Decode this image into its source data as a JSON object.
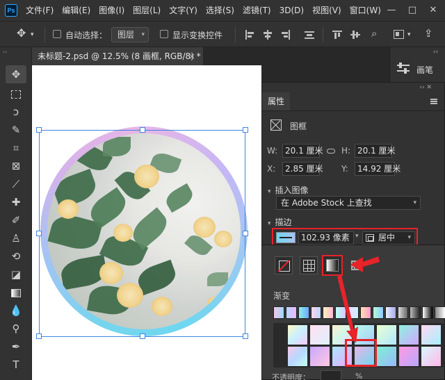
{
  "app": {
    "logo_text": "Ps",
    "menu": [
      "文件(F)",
      "编辑(E)",
      "图像(I)",
      "图层(L)",
      "文字(Y)",
      "选择(S)",
      "滤镜(T)",
      "3D(D)",
      "视图(V)",
      "窗口(W)"
    ],
    "window_controls": [
      "—",
      "□",
      "✕"
    ]
  },
  "options_bar": {
    "auto_select_label": "自动选择：",
    "auto_select_value": "图层",
    "show_transform_label": "显示变换控件"
  },
  "document": {
    "tab_title": "未标题-2.psd @ 12.5% (8 画框, RGB/8) *",
    "close": "×"
  },
  "dock": {
    "artboard_label": "画笔",
    "collapse": "‹‹"
  },
  "properties": {
    "tab_label": "属性",
    "collapse": "›› ✕",
    "frame_label": "图框",
    "w_label": "W:",
    "w_value": "20.1 厘米",
    "h_label": "H:",
    "h_value": "20.1 厘米",
    "x_label": "X:",
    "x_value": "2.85 厘米",
    "y_label": "Y:",
    "y_value": "14.92 厘米",
    "insert_image_title": "插入图像",
    "stock_search": "在 Adobe Stock 上查找",
    "stroke_title": "描边",
    "stroke_width": "102.93 像素",
    "stroke_align": "居中"
  },
  "stroke_popup": {
    "gradient_label": "渐变",
    "opacity_label": "不透明度：",
    "opacity_suffix": "%"
  },
  "colors": {
    "accent_red": "#e8232a",
    "selection_blue": "#3d86e0",
    "ring_pink": "#e8b6e6",
    "ring_blue": "#6fd7f0"
  },
  "icons": {
    "move_tool": "move-icon",
    "marquee_tool": "rect-marquee-icon",
    "lasso_tool": "lasso-icon",
    "quick_select_tool": "quick-select-icon",
    "crop_tool": "crop-icon",
    "frame_tool": "frame-icon",
    "eyedropper_tool": "eyedropper-icon",
    "healing_tool": "healing-icon",
    "brush_tool": "brush-icon",
    "stamp_tool": "clone-stamp-icon",
    "history_brush_tool": "history-brush-icon",
    "eraser_tool": "eraser-icon",
    "gradient_tool": "gradient-icon",
    "blur_tool": "blur-icon",
    "dodge_tool": "dodge-icon",
    "pen_tool": "pen-icon",
    "type_tool": "type-icon"
  }
}
